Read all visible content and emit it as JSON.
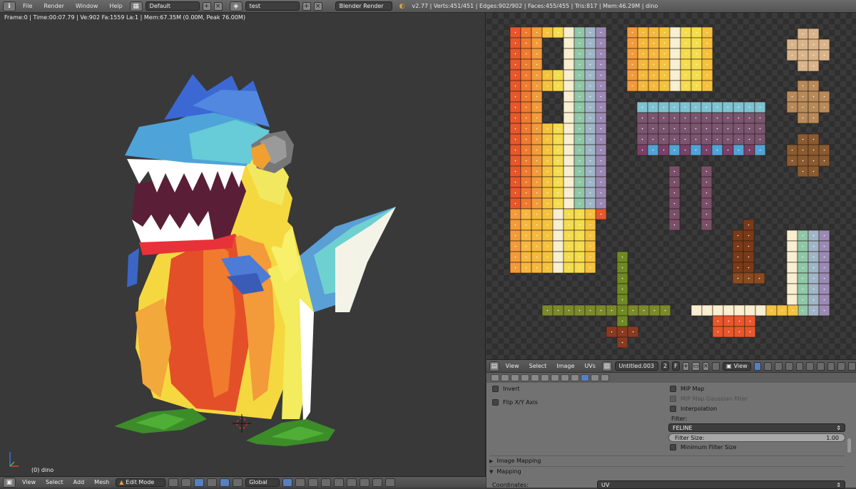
{
  "topbar": {
    "menus": [
      "File",
      "Render",
      "Window",
      "Help"
    ],
    "screen_layout": "Default",
    "scene": "test",
    "render_engine": "Blender Render",
    "stats": "v2.77 | Verts:451/451 | Edges:902/902 | Faces:455/455 | Tris:817 | Mem:46.29M | dino"
  },
  "viewport": {
    "info": "Frame:0 | Time:00:07.79 | Ve:902 Fa:1559 La:1 | Mem:67.35M (0.00M, Peak 76.00M)",
    "object_label": "(0) dino"
  },
  "viewport_header": {
    "menus": [
      "View",
      "Select",
      "Add",
      "Mesh"
    ],
    "mode": "Edit Mode",
    "orientation": "Global"
  },
  "uv_header": {
    "menus": [
      "View",
      "Select",
      "Image",
      "UVs"
    ],
    "image_name": "Untitled.003",
    "users": "2",
    "fake_user": "F",
    "view_label": "View"
  },
  "properties": {
    "invert": "Invert",
    "flip_axis": "Flip X/Y Axis",
    "mip_map": "MIP Map",
    "mip_map_gaussian": "MIP Map Gaussian filter",
    "interpolation": "Interpolation",
    "filter_label": "Filter:",
    "filter_value": "FELINE",
    "filter_size_label": "Filter Size:",
    "filter_size_value": "1.00",
    "min_filter_size": "Minimum Filter Size",
    "panel_image_mapping": "Image Mapping",
    "panel_mapping": "Mapping",
    "coordinates_label": "Coordinates:",
    "coordinates_value": "UV"
  },
  "colors": {
    "header": "#5a5a5a",
    "viewport_bg": "#393939",
    "selected_accent": "#5680c2",
    "properties_bg": "#727272"
  }
}
